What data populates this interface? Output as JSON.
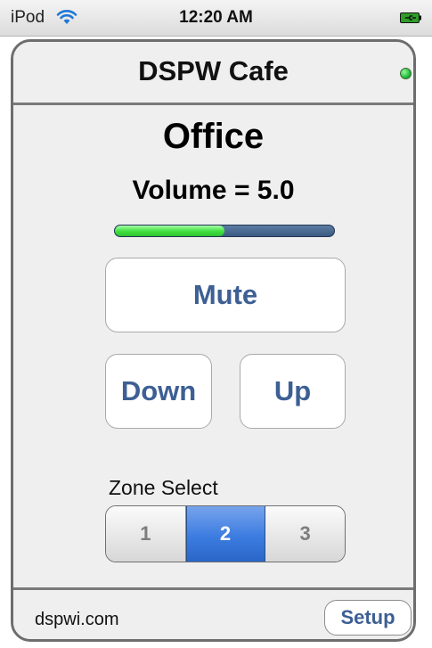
{
  "status_bar": {
    "carrier": "iPod",
    "time": "12:20 AM",
    "wifi_icon": "wifi-icon",
    "battery_icon": "battery-charging-icon"
  },
  "header": {
    "title": "DSPW Cafe",
    "status_led_color": "#1fbe3a"
  },
  "zone": {
    "name": "Office",
    "volume_text": "Volume = 5.0",
    "volume_level_fraction": 0.5
  },
  "buttons": {
    "mute": "Mute",
    "down": "Down",
    "up": "Up"
  },
  "zone_select": {
    "label": "Zone Select",
    "options": [
      "1",
      "2",
      "3"
    ],
    "selected": "2"
  },
  "footer": {
    "link_text": "dspwi.com",
    "setup_label": "Setup"
  },
  "colors": {
    "accent_text": "#3d5f94",
    "selected_segment": "#3c7ce0"
  }
}
